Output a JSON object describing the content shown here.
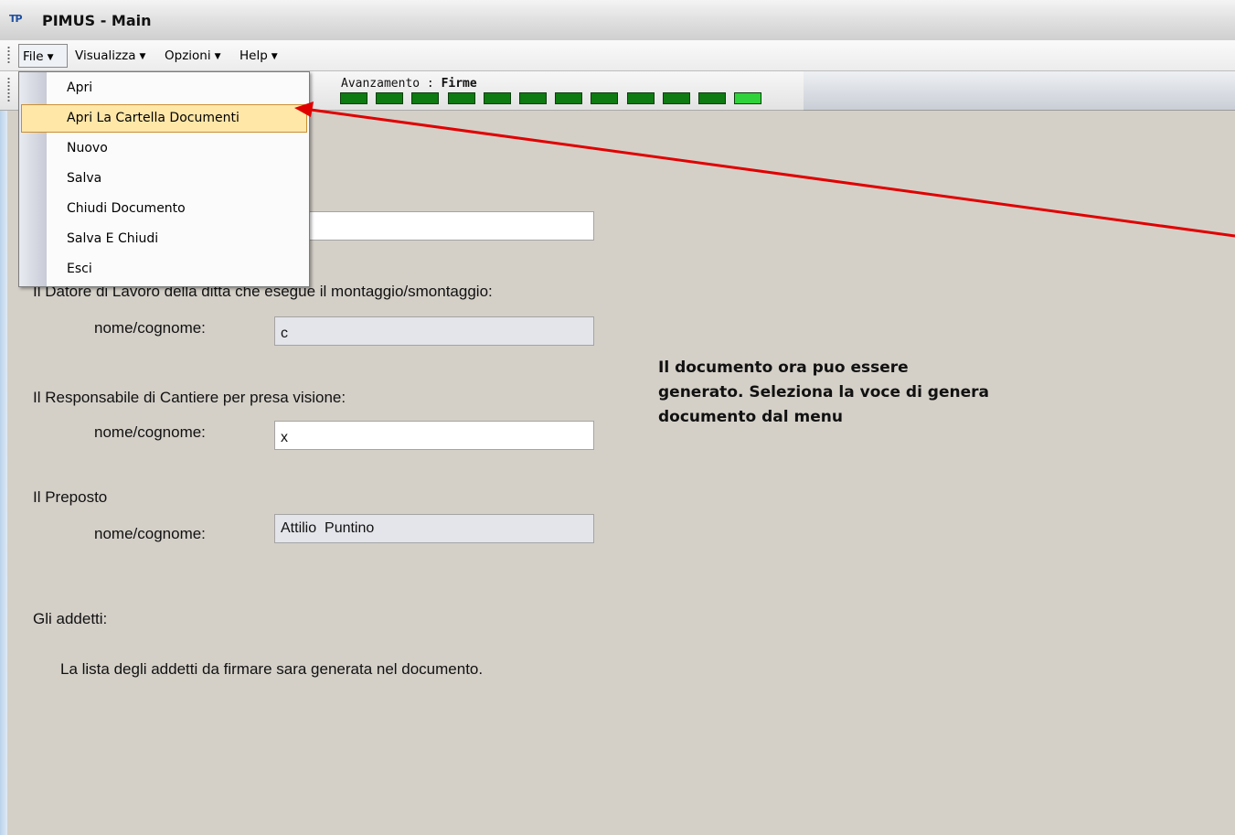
{
  "window": {
    "icon_text": "TP",
    "title": "PIMUS - Main"
  },
  "menubar": {
    "items": [
      {
        "label": "File"
      },
      {
        "label": "Visualizza"
      },
      {
        "label": "Opzioni"
      },
      {
        "label": "Help"
      }
    ]
  },
  "file_menu": {
    "items": [
      {
        "label": "Apri"
      },
      {
        "label": "Apri La Cartella Documenti",
        "hovered": true
      },
      {
        "label": "Nuovo"
      },
      {
        "label": "Salva"
      },
      {
        "label": "Chiudi Documento"
      },
      {
        "label": "Salva E Chiudi"
      },
      {
        "label": "Esci"
      }
    ]
  },
  "progress": {
    "label": "Avanzamento : ",
    "stage": "Firme",
    "completed_segments": 11,
    "total_segments": 12
  },
  "form": {
    "datore_heading": "Il Datore di Lavoro della ditta che esegue il montaggio/smontaggio:",
    "datore_name_label": "nome/cognome:",
    "datore_name_value": "c",
    "responsabile_heading": "Il Responsabile di Cantiere per presa visione:",
    "responsabile_name_label": "nome/cognome:",
    "responsabile_name_value": "x",
    "preposto_heading": "Il Preposto",
    "preposto_name_label": "nome/cognome:",
    "preposto_name_value": "Attilio  Puntino",
    "addetti_heading": "Gli addetti:",
    "addetti_text": "La lista degli addetti da firmare sara generata nel documento."
  },
  "info_message": {
    "line1": "Il documento ora puo essere",
    "line2": "generato. Seleziona la voce di genera",
    "line3": "documento dal menu"
  },
  "colors": {
    "background": "#d4d0c8",
    "progress_done": "#0e7a12",
    "progress_current": "#2fd23a",
    "menu_hover": "#ffe7a8",
    "annotation_arrow": "#e00000"
  }
}
